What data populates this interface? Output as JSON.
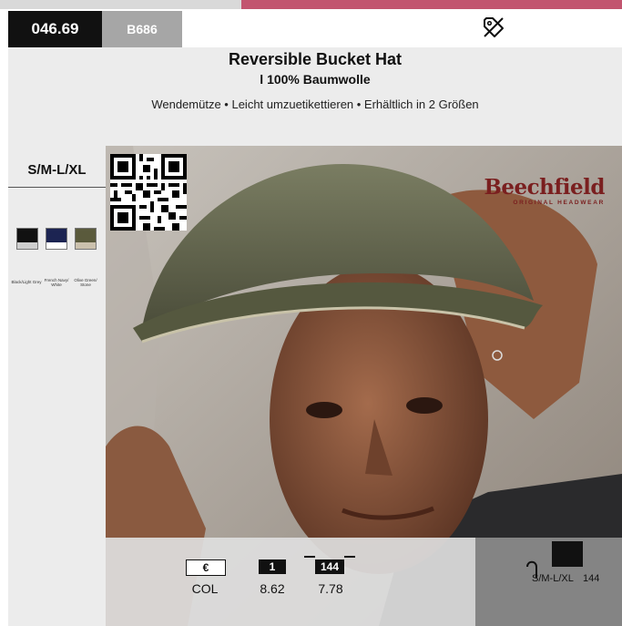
{
  "header": {
    "article_number": "046.69",
    "product_code": "B686"
  },
  "product": {
    "title": "Reversible Bucket Hat",
    "subtitle": "l 100% Baumwolle",
    "features": "Wendemütze • Leicht umzuetikettieren • Erhältlich in 2 Größen"
  },
  "sizes": "S/M-L/XL",
  "colors": [
    {
      "label": "Black/Light Grey",
      "top_color": "#111111",
      "bottom_color": "#cfcfcf"
    },
    {
      "label": "French Navy/ White",
      "top_color": "#1c2452",
      "bottom_color": "#ffffff"
    },
    {
      "label": "Olive Green/ Stone",
      "top_color": "#5a5a3c",
      "bottom_color": "#cbc1ad"
    }
  ],
  "brand": {
    "name": "Beechfield",
    "tagline": "ORIGINAL HEADWEAR"
  },
  "pricing": {
    "currency_symbol": "€",
    "currency_label": "COL",
    "qty_1_label": "1",
    "qty_1_price": "8.62",
    "qty_2_label": "144",
    "qty_2_price": "7.78"
  },
  "packaging": {
    "sizes": "S/M-L/XL",
    "quantity": "144"
  },
  "icons": {
    "tag": "price-tag-icon",
    "qr": "qr-code",
    "box": "carton-icon",
    "hanger": "hanger-icon"
  }
}
